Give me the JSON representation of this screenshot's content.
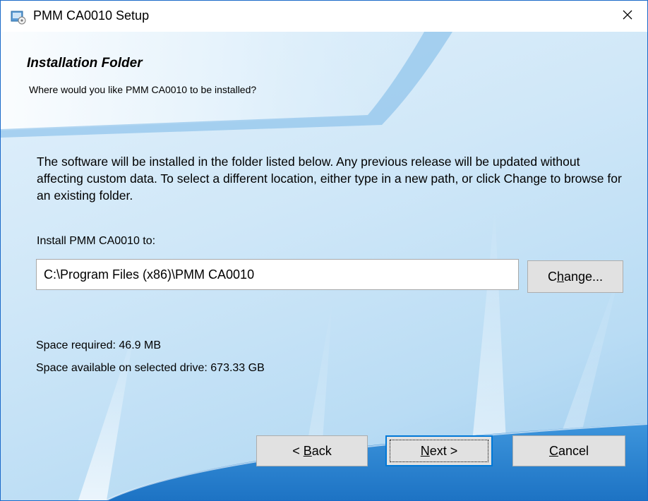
{
  "window": {
    "title": "PMM CA0010 Setup",
    "app_icon": "installer-icon",
    "close_icon": "close-icon"
  },
  "header": {
    "title": "Installation Folder",
    "subtitle": "Where would you like PMM CA0010 to be installed?"
  },
  "body": {
    "description": "The software will be installed in the folder listed below. Any previous release will be updated without affecting custom data. To select a different location, either type in a new path, or click Change to browse for an existing folder.",
    "install_label": "Install PMM CA0010 to:",
    "install_path": "C:\\Program Files (x86)\\PMM CA0010",
    "change_button": {
      "pre": "C",
      "accel": "h",
      "post": "ange..."
    },
    "space_required": "Space required: 46.9 MB",
    "space_available": "Space available on selected drive: 673.33 GB"
  },
  "footer": {
    "back_button": {
      "pre": "< ",
      "accel": "B",
      "post": "ack"
    },
    "next_button": {
      "pre": "",
      "accel": "N",
      "post": "ext >"
    },
    "cancel_button": {
      "pre": "",
      "accel": "C",
      "post": "ancel"
    }
  },
  "colors": {
    "window_border": "#1b6ac9",
    "background_light": "#e3f1fb",
    "background_dark": "#9ccbee",
    "button_face": "#e1e1e1",
    "default_button_border": "#0078d7"
  }
}
